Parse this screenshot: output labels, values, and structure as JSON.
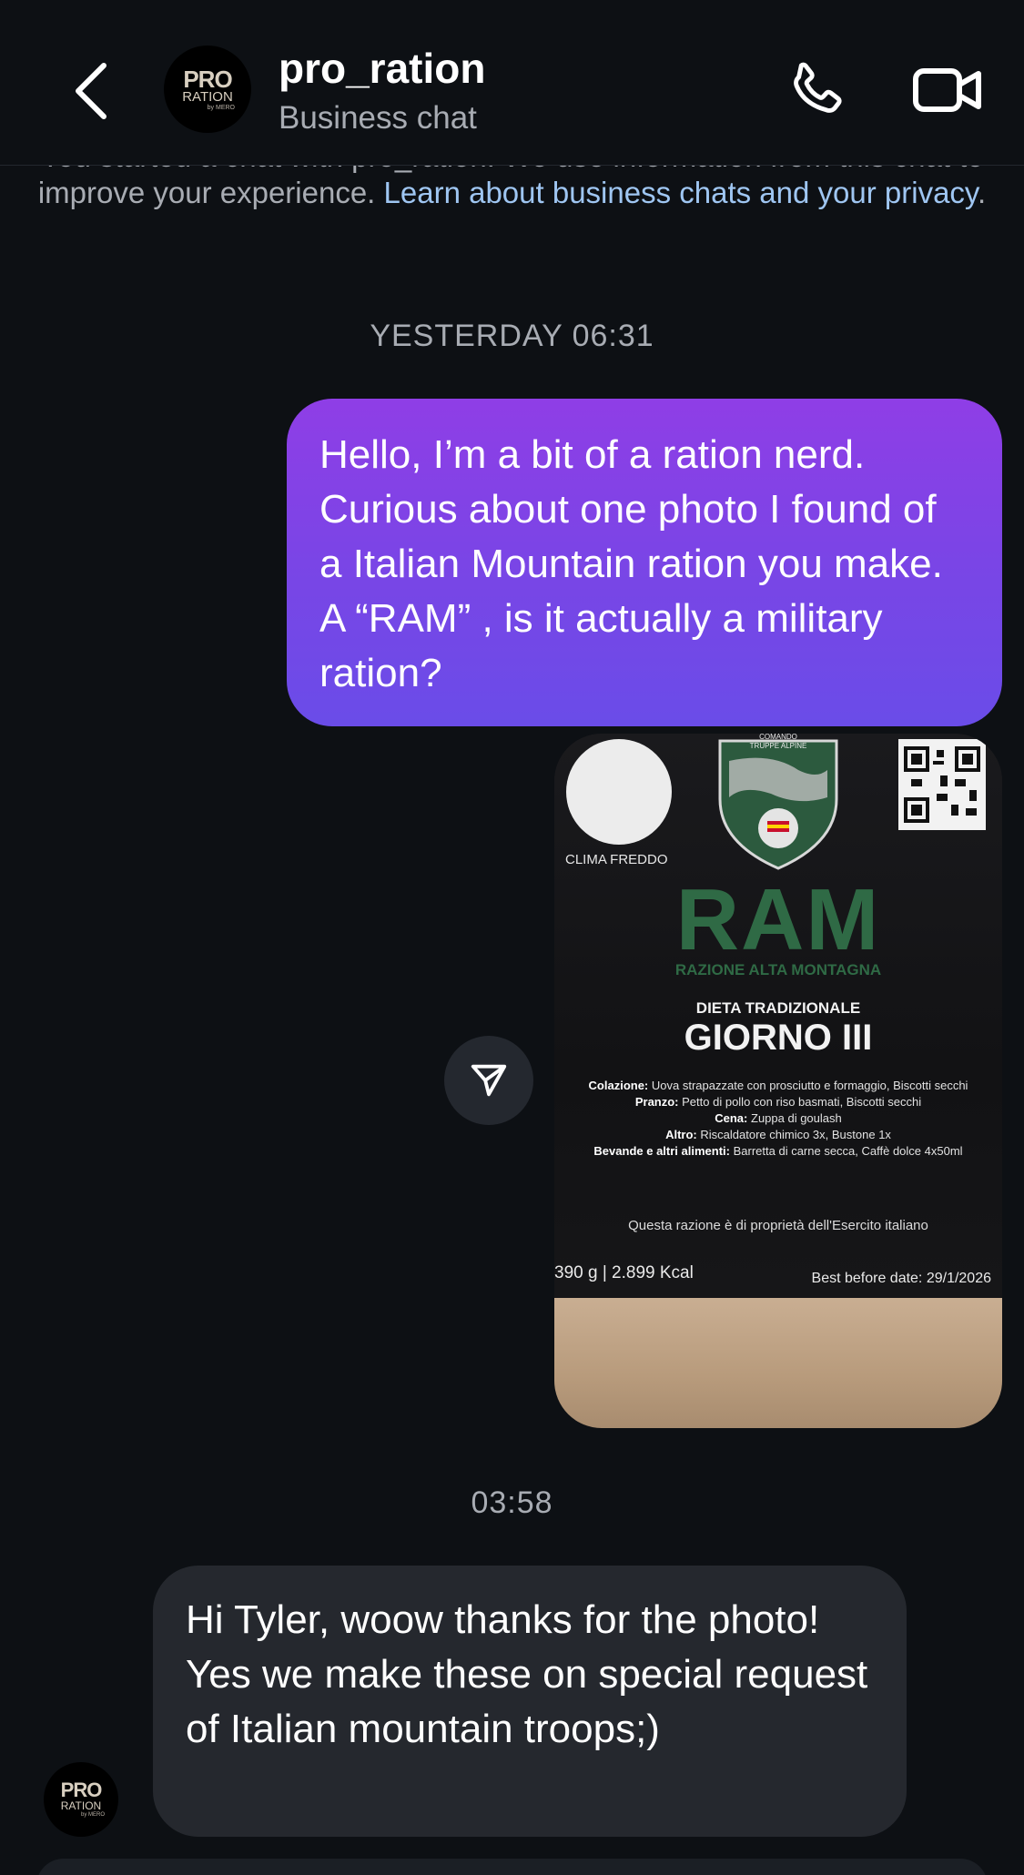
{
  "header": {
    "name": "pro_ration",
    "subtitle": "Business chat",
    "avatar": {
      "line1": "PRO",
      "line2": "RATION",
      "line3": "by MERO"
    }
  },
  "notice": {
    "text": "You started a chat with pro_ration. We use information from this chat to improve your experience.",
    "link": "Learn about business chats and your privacy",
    "period": "."
  },
  "timestamps": {
    "first": "YESTERDAY 06:31",
    "second": "03:58"
  },
  "messages": {
    "outgoing": "Hello, I’m a bit of a ration nerd. Curious about one photo I found of a Italian Mountain ration you make. A “RAM” , is it actually a military ration?",
    "incoming": "Hi Tyler, woow thanks for the photo! Yes we make these on special request of Italian mountain troops;)"
  },
  "photo": {
    "clima": "CLIMA FREDDO",
    "shield_top": "COMANDO TRUPPE ALPINE",
    "title": "RAM",
    "subtitle": "RAZIONE ALTA MONTAGNA",
    "dieta": "DIETA TRADIZIONALE",
    "giorno": "GIORNO III",
    "menu": [
      {
        "label": "Colazione:",
        "text": "Uova strapazzate con prosciutto e formaggio, Biscotti secchi"
      },
      {
        "label": "Pranzo:",
        "text": "Petto di pollo con riso basmati, Biscotti secchi"
      },
      {
        "label": "Cena:",
        "text": "Zuppa di goulash"
      },
      {
        "label": "Altro:",
        "text": "Riscaldatore chimico 3x, Bustone 1x"
      },
      {
        "label": "Bevande e altri alimenti:",
        "text": "Barretta di carne secca, Caffè dolce 4x50ml"
      }
    ],
    "property": "Questa razione è di proprietà dell'Esercito italiano",
    "weight": "390 g | 2.899 Kcal",
    "best_before": "Best before date: 29/1/2026"
  },
  "icons": {
    "back": "chevron-left-icon",
    "call": "phone-icon",
    "video": "video-camera-icon",
    "share": "send-icon"
  },
  "colors": {
    "background": "#0d1014",
    "outgoing_bubble": "#7a45e6",
    "incoming_bubble": "#25282e",
    "link": "#9fc6f2"
  }
}
